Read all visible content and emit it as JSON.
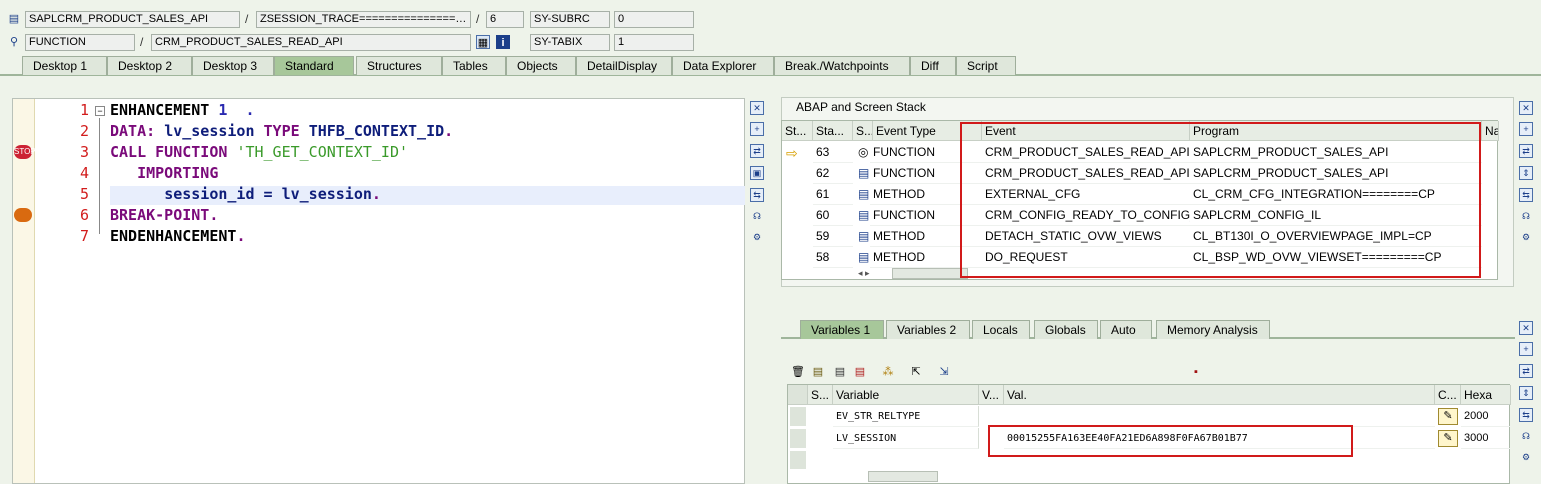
{
  "top": {
    "row1": {
      "program": "SAPLCRM_PRODUCT_SALES_API",
      "include": "ZSESSION_TRACE===============…",
      "line": "6",
      "sysvar": "SY-SUBRC",
      "sysval": "0"
    },
    "row2": {
      "type": "FUNCTION",
      "name": "CRM_PRODUCT_SALES_READ_API",
      "sysvar": "SY-TABIX",
      "sysval": "1"
    },
    "slash": "/"
  },
  "tabs": [
    "Desktop 1",
    "Desktop 2",
    "Desktop 3",
    "Standard",
    "Structures",
    "Tables",
    "Objects",
    "DetailDisplay",
    "Data Explorer",
    "Break./Watchpoints",
    "Diff",
    "Script"
  ],
  "editor": {
    "lines": [
      "1",
      "2",
      "3",
      "4",
      "5",
      "6",
      "7"
    ],
    "l1": {
      "kw": "ENHANCEMENT",
      "rest": " 1  ."
    },
    "l2": {
      "kw1": "DATA:",
      "var": "lv_session",
      "kw2": "TYPE",
      "type": "THFB_CONTEXT_ID",
      "end": "."
    },
    "l3": {
      "kw": "CALL FUNCTION",
      "str": "'TH_GET_CONTEXT_ID'"
    },
    "l4": {
      "kw": "IMPORTING"
    },
    "l5": {
      "a": "session_id",
      "eq": " = ",
      "b": "lv_session",
      "end": "."
    },
    "l6": {
      "kw": "BREAK-POINT",
      "end": "."
    },
    "l7": {
      "kw": "ENDENHANCEMENT",
      "end": "."
    }
  },
  "stack": {
    "title": "ABAP and Screen Stack",
    "headers": [
      "St...",
      "Sta...",
      "S...",
      "Event Type",
      "Event",
      "Program",
      "Na"
    ],
    "rows": [
      {
        "level": "63",
        "type": "FUNCTION",
        "event": "CRM_PRODUCT_SALES_READ_API",
        "program": "SAPLCRM_PRODUCT_SALES_API"
      },
      {
        "level": "62",
        "type": "FUNCTION",
        "event": "CRM_PRODUCT_SALES_READ_API",
        "program": "SAPLCRM_PRODUCT_SALES_API"
      },
      {
        "level": "61",
        "type": "METHOD",
        "event": "EXTERNAL_CFG",
        "program": "CL_CRM_CFG_INTEGRATION========CP"
      },
      {
        "level": "60",
        "type": "FUNCTION",
        "event": "CRM_CONFIG_READY_TO_CONFIG_IL",
        "program": "SAPLCRM_CONFIG_IL"
      },
      {
        "level": "59",
        "type": "METHOD",
        "event": "DETACH_STATIC_OVW_VIEWS",
        "program": "CL_BT130I_O_OVERVIEWPAGE_IMPL=CP"
      },
      {
        "level": "58",
        "type": "METHOD",
        "event": "DO_REQUEST",
        "program": "CL_BSP_WD_OVW_VIEWSET=========CP"
      }
    ]
  },
  "vartabs": [
    "Variables 1",
    "Variables 2",
    "Locals",
    "Globals",
    "Auto",
    "Memory Analysis"
  ],
  "vars": {
    "headers": [
      "S...",
      "Variable",
      "V...",
      "Val.",
      "C...",
      "Hexa"
    ],
    "rows": [
      {
        "name": "EV_STR_RELTYPE",
        "value": "",
        "hex": "2000"
      },
      {
        "name": "LV_SESSION",
        "value": "00015255FA163EE40FA21ED6A898F0FA67B01B77",
        "hex": "3000"
      }
    ]
  },
  "colors": {
    "highlight": "#d11a1a",
    "activeTab": "#a7c79a",
    "keyword": "#7a0a7a",
    "string": "#3a9a2a"
  }
}
